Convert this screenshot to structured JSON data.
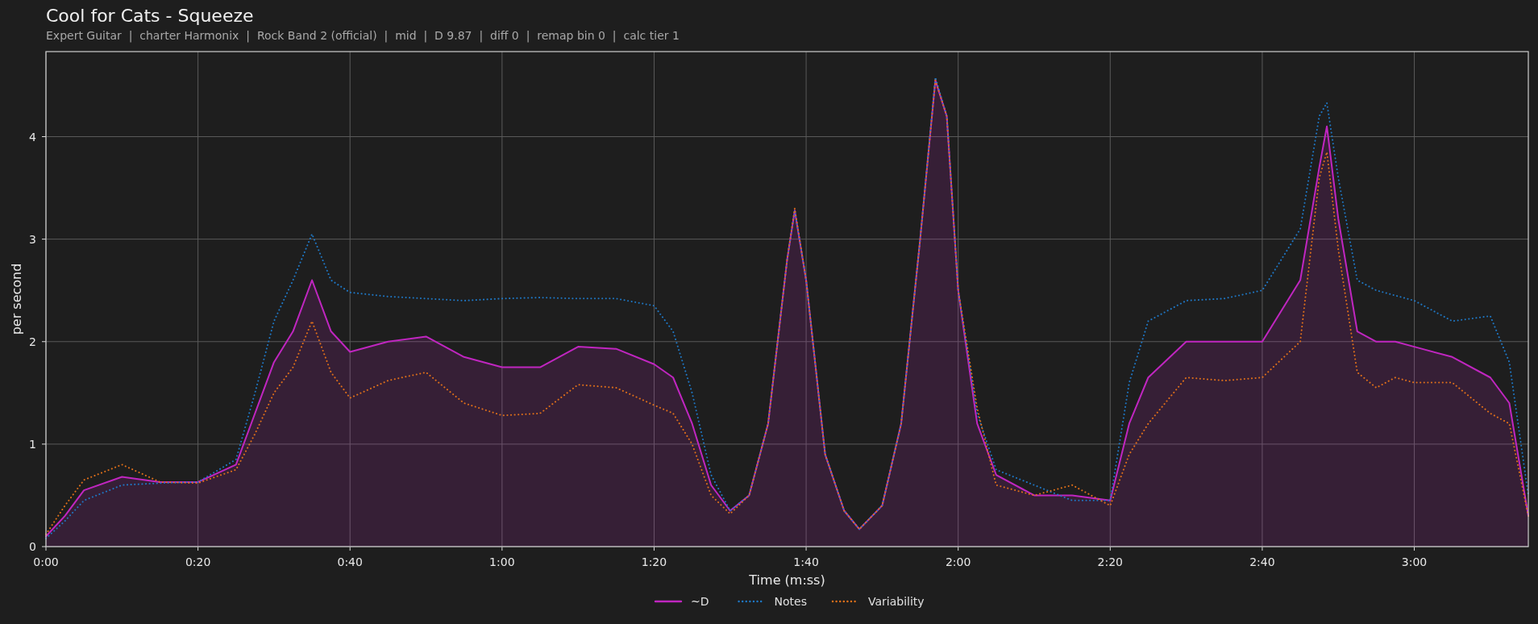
{
  "title": "Cool for Cats - Squeeze",
  "subtitle": "Expert Guitar  |  charter Harmonix  |  Rock Band 2 (official)  |  mid  |  D 9.87  |  diff 0  |  remap bin 0  |  calc tier 1",
  "chart": {
    "chart_data": {
      "type": "line",
      "xlabel": "Time (m:ss)",
      "ylabel": "per second",
      "x": [
        0,
        2.5,
        5,
        10,
        15,
        20,
        25,
        27.5,
        30,
        32.5,
        35,
        37.5,
        40,
        45,
        50,
        55,
        60,
        65,
        70,
        75,
        80,
        82.5,
        85,
        87.5,
        90,
        92.5,
        95,
        97.5,
        98.5,
        100,
        102.5,
        105,
        107,
        110,
        112.5,
        115,
        117,
        118.5,
        120,
        122.5,
        125,
        130,
        135,
        140,
        142.5,
        145,
        150,
        155,
        160,
        165,
        167.5,
        168.5,
        170,
        172.5,
        175,
        177.5,
        180,
        185,
        190,
        192.5,
        195
      ],
      "series": [
        {
          "name": "~D",
          "color": "#c026c0",
          "type": "area",
          "line_style": "solid",
          "values": [
            0.1,
            0.3,
            0.55,
            0.68,
            0.63,
            0.63,
            0.8,
            1.3,
            1.8,
            2.1,
            2.6,
            2.1,
            1.9,
            2.0,
            2.05,
            1.85,
            1.75,
            1.75,
            1.95,
            1.93,
            1.78,
            1.65,
            1.2,
            0.6,
            0.35,
            0.5,
            1.2,
            2.8,
            3.28,
            2.6,
            0.9,
            0.35,
            0.17,
            0.4,
            1.2,
            3.0,
            4.55,
            4.2,
            2.5,
            1.2,
            0.7,
            0.5,
            0.5,
            0.45,
            1.2,
            1.65,
            2.0,
            2.0,
            2.0,
            2.6,
            3.7,
            4.1,
            3.2,
            2.1,
            2.0,
            2.0,
            1.95,
            1.85,
            1.65,
            1.4,
            0.3
          ]
        },
        {
          "name": "Notes",
          "color": "#1f77c4",
          "type": "line",
          "line_style": "dotted",
          "values": [
            0.08,
            0.25,
            0.45,
            0.6,
            0.62,
            0.63,
            0.85,
            1.5,
            2.2,
            2.6,
            3.05,
            2.6,
            2.48,
            2.44,
            2.42,
            2.4,
            2.42,
            2.43,
            2.42,
            2.42,
            2.35,
            2.1,
            1.5,
            0.7,
            0.35,
            0.5,
            1.2,
            2.8,
            3.28,
            2.6,
            0.9,
            0.35,
            0.17,
            0.4,
            1.2,
            3.0,
            4.58,
            4.2,
            2.5,
            1.3,
            0.75,
            0.6,
            0.45,
            0.45,
            1.6,
            2.2,
            2.4,
            2.42,
            2.5,
            3.1,
            4.2,
            4.33,
            3.6,
            2.6,
            2.5,
            2.45,
            2.4,
            2.2,
            2.25,
            1.8,
            0.5
          ]
        },
        {
          "name": "Variability",
          "color": "#e0701a",
          "type": "line",
          "line_style": "dotted",
          "values": [
            0.12,
            0.4,
            0.65,
            0.8,
            0.63,
            0.62,
            0.75,
            1.1,
            1.5,
            1.75,
            2.2,
            1.7,
            1.45,
            1.62,
            1.7,
            1.4,
            1.28,
            1.3,
            1.58,
            1.55,
            1.38,
            1.3,
            1.0,
            0.5,
            0.32,
            0.5,
            1.2,
            2.8,
            3.3,
            2.6,
            0.9,
            0.35,
            0.17,
            0.4,
            1.2,
            3.0,
            4.55,
            4.2,
            2.5,
            1.35,
            0.6,
            0.5,
            0.6,
            0.4,
            0.9,
            1.2,
            1.65,
            1.62,
            1.65,
            2.0,
            3.6,
            3.85,
            2.9,
            1.7,
            1.55,
            1.65,
            1.6,
            1.6,
            1.3,
            1.2,
            0.3
          ]
        }
      ],
      "grid": true,
      "legend": true,
      "xlim": [
        0,
        195
      ],
      "ylim": [
        0,
        4.83
      ],
      "xticks": [
        {
          "value": 0,
          "label": "0:00"
        },
        {
          "value": 20,
          "label": "0:20"
        },
        {
          "value": 40,
          "label": "0:40"
        },
        {
          "value": 60,
          "label": "1:00"
        },
        {
          "value": 80,
          "label": "1:20"
        },
        {
          "value": 100,
          "label": "1:40"
        },
        {
          "value": 120,
          "label": "2:00"
        },
        {
          "value": 140,
          "label": "2:20"
        },
        {
          "value": 160,
          "label": "2:40"
        },
        {
          "value": 180,
          "label": "3:00"
        }
      ],
      "yticks": [
        0,
        1,
        2,
        3,
        4
      ]
    }
  }
}
